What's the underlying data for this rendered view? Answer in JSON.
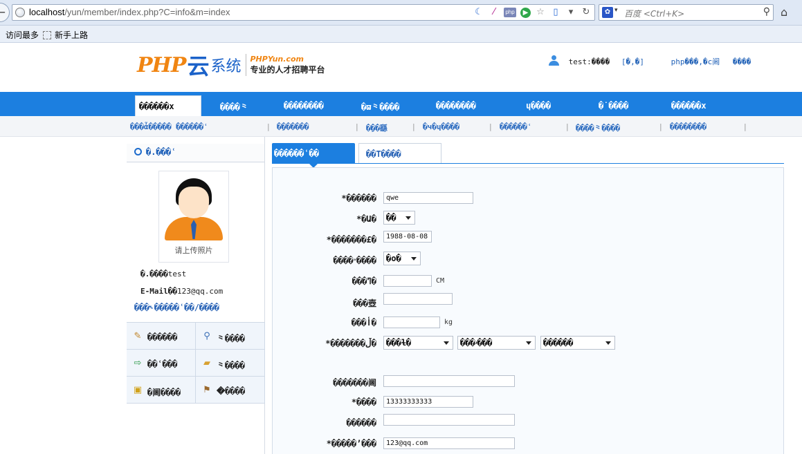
{
  "browser": {
    "url_host": "localhost",
    "url_rest": "/yun/member/index.php?C=info&m=index",
    "search_placeholder": "百度 <Ctrl+K>",
    "bookmarks": [
      "访问最多",
      "新手上路"
    ]
  },
  "header": {
    "logo_php": "PHP",
    "logo_yun": "云",
    "logo_sys": "系统",
    "brand": "PHPYun.com",
    "tagline": "专业的人才招聘平台",
    "user_name": "test:����",
    "user_links": [
      "[�,�]",
      "php���,�c阃",
      "����"
    ]
  },
  "mainnav": {
    "active": "������x",
    "items": [
      "����⺀",
      "��������",
      "�ϖ⺀����",
      "��������",
      "ɥ����",
      "�˙����",
      "������x"
    ]
  },
  "subnav": {
    "items": [
      "���ἆ����� ������ՙ",
      "��ِ�����",
      "��ِ�繇",
      "�ч�ɥ����",
      "������ՙ",
      "����⺀����",
      "��������"
    ]
  },
  "sidebar": {
    "title": "�.���ՙ",
    "avatar_caption": "请上传照片",
    "name_label": "�.����",
    "name_value": "test",
    "email_label": "E-Mail��",
    "email_value": "123@qq.com",
    "link": "���˞�����ՙ��/����",
    "menu": [
      {
        "icon": "edit-icon",
        "label": "������"
      },
      {
        "icon": "magnifier-icon",
        "label": "⺀����"
      },
      {
        "icon": "export-icon",
        "label": "��ՙ���"
      },
      {
        "icon": "folder-icon",
        "label": "⺀����"
      },
      {
        "icon": "lock-icon",
        "label": "�阃����"
      },
      {
        "icon": "signpost-icon",
        "label": "�ׁ����"
      }
    ]
  },
  "tabs": {
    "active": "������ՙ��",
    "second": "��T����"
  },
  "form": {
    "name_label": "*������",
    "name_value": "qwe",
    "gender_label": "*�Ա�",
    "gender_value": "��",
    "birthday_label": "*�������£�",
    "birthday_value": "1988-08-08",
    "marital_label": "����״����",
    "marital_value": "�о�",
    "height_label": "���ߣ�",
    "height_value": "",
    "height_unit": "CM",
    "ethnic_label": "���壺",
    "ethnic_value": "",
    "weight_label": "���أ�",
    "weight_value": "",
    "weight_unit": "kg",
    "region_label": "*�������ڵ�",
    "region_province": "���ɫ�",
    "region_city": "���ۥ���",
    "region_district": "������",
    "extra_label": "�������阃",
    "extra_value": "",
    "phone_label": "*����",
    "phone_value": "13333333333",
    "tel_label": "������",
    "tel_value": "",
    "email_label": "*�����ʼ���",
    "email_value": "123@qq.com"
  }
}
